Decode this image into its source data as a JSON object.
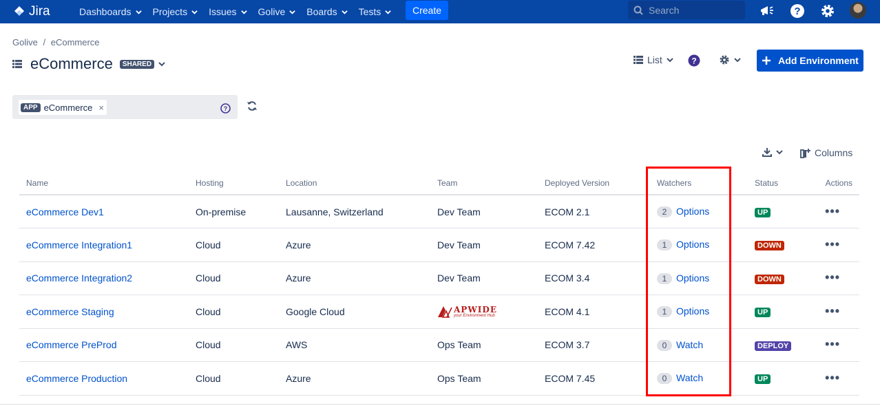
{
  "topbar": {
    "logo_text": "Jira",
    "nav": [
      "Dashboards",
      "Projects",
      "Issues",
      "Golive",
      "Boards",
      "Tests"
    ],
    "create_label": "Create",
    "search_placeholder": "Search",
    "colors": {
      "bar": "#0747a6",
      "create": "#0065ff"
    }
  },
  "breadcrumb": {
    "root": "Golive",
    "separator": "/",
    "current": "eCommerce"
  },
  "page": {
    "title": "eCommerce",
    "shared_badge": "SHARED"
  },
  "toolbar": {
    "view_label": "List",
    "add_env_label": "Add Environment"
  },
  "filter": {
    "chip_tag": "APP",
    "chip_value": "eCommerce",
    "chip_remove": "×"
  },
  "table_tools": {
    "columns_label": "Columns"
  },
  "table": {
    "headers": [
      "Name",
      "Hosting",
      "Location",
      "Team",
      "Deployed Version",
      "Watchers",
      "Status",
      "Actions"
    ],
    "rows": [
      {
        "name": "eCommerce Dev1",
        "hosting": "On-premise",
        "location": "Lausanne, Switzerland",
        "team": "Dev Team",
        "version": "ECOM 2.1",
        "watch_count": "2",
        "watch_label": "Options",
        "status": "UP",
        "status_color": "#00875a"
      },
      {
        "name": "eCommerce Integration1",
        "hosting": "Cloud",
        "location": "Azure",
        "team": "Dev Team",
        "version": "ECOM 7.42",
        "watch_count": "1",
        "watch_label": "Options",
        "status": "DOWN",
        "status_color": "#bf2600"
      },
      {
        "name": "eCommerce Integration2",
        "hosting": "Cloud",
        "location": "Azure",
        "team": "Dev Team",
        "version": "ECOM 3.4",
        "watch_count": "1",
        "watch_label": "Options",
        "status": "DOWN",
        "status_color": "#bf2600"
      },
      {
        "name": "eCommerce Staging",
        "hosting": "Cloud",
        "location": "Google Cloud",
        "team": "",
        "team_logo": "APWIDE",
        "team_logo_sub": "your Environment Hub",
        "version": "ECOM 4.1",
        "watch_count": "1",
        "watch_label": "Options",
        "status": "UP",
        "status_color": "#00875a"
      },
      {
        "name": "eCommerce PreProd",
        "hosting": "Cloud",
        "location": "AWS",
        "team": "Ops Team",
        "version": "ECOM 3.7",
        "watch_count": "0",
        "watch_label": "Watch",
        "status": "DEPLOY",
        "status_color": "#5243aa"
      },
      {
        "name": "eCommerce Production",
        "hosting": "Cloud",
        "location": "Azure",
        "team": "Ops Team",
        "version": "ECOM 7.45",
        "watch_count": "0",
        "watch_label": "Watch",
        "status": "UP",
        "status_color": "#00875a"
      }
    ],
    "actions_glyph": "•••"
  },
  "annotation": {
    "highlight_color": "#ff0000"
  }
}
